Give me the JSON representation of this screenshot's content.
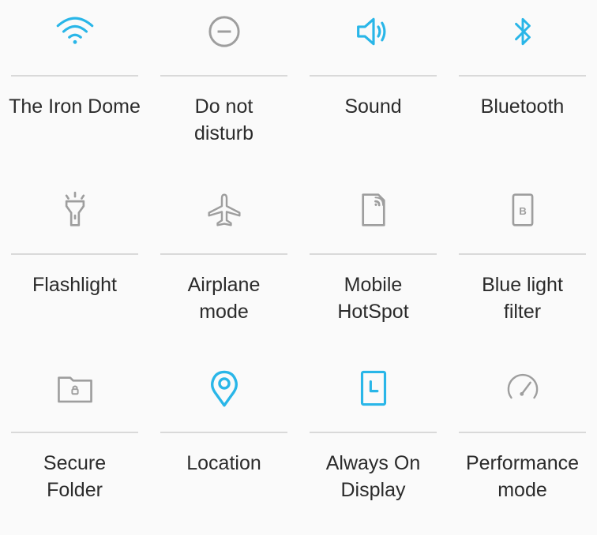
{
  "colors": {
    "active": "#29b6e8",
    "inactive": "#9e9e9e",
    "label": "#2b2b2b"
  },
  "tiles": [
    {
      "label": "The Iron Dome",
      "icon": "wifi-icon",
      "active": true
    },
    {
      "label": "Do not\ndisturb",
      "icon": "do-not-disturb-icon",
      "active": false
    },
    {
      "label": "Sound",
      "icon": "sound-icon",
      "active": true
    },
    {
      "label": "Bluetooth",
      "icon": "bluetooth-icon",
      "active": true
    },
    {
      "label": "Flashlight",
      "icon": "flashlight-icon",
      "active": false
    },
    {
      "label": "Airplane\nmode",
      "icon": "airplane-icon",
      "active": false
    },
    {
      "label": "Mobile\nHotSpot",
      "icon": "hotspot-icon",
      "active": false
    },
    {
      "label": "Blue light\nfilter",
      "icon": "blue-light-filter-icon",
      "active": false
    },
    {
      "label": "Secure\nFolder",
      "icon": "secure-folder-icon",
      "active": false
    },
    {
      "label": "Location",
      "icon": "location-icon",
      "active": true
    },
    {
      "label": "Always On\nDisplay",
      "icon": "always-on-display-icon",
      "active": true
    },
    {
      "label": "Performance\nmode",
      "icon": "performance-icon",
      "active": false
    }
  ]
}
